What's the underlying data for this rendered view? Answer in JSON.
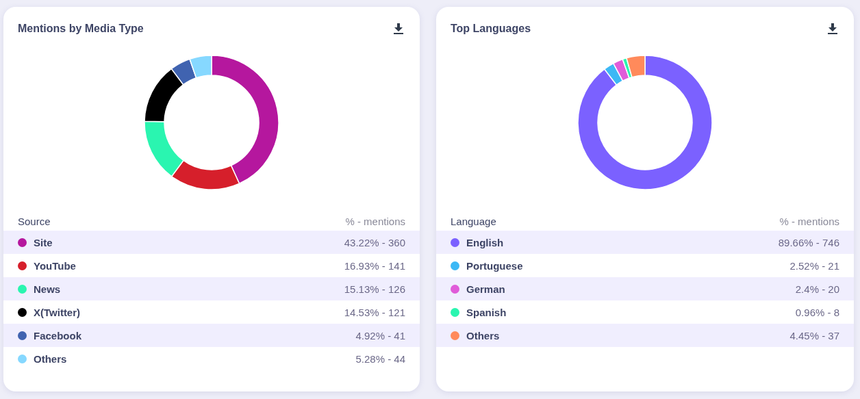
{
  "cards": [
    {
      "title": "Mentions by Media Type",
      "label_header": "Source",
      "value_header": "% - mentions",
      "chart_data": {
        "type": "donut",
        "values": [
          43.22,
          16.93,
          15.13,
          14.53,
          4.92,
          5.28
        ]
      },
      "rows": [
        {
          "label": "Site",
          "value": "43.22% - 360",
          "color": "#b5179e"
        },
        {
          "label": "YouTube",
          "value": "16.93% - 141",
          "color": "#d61f2b"
        },
        {
          "label": "News",
          "value": "15.13% - 126",
          "color": "#2af5b0"
        },
        {
          "label": "X(Twitter)",
          "value": "14.53% - 121",
          "color": "#000000"
        },
        {
          "label": "Facebook",
          "value": "4.92% - 41",
          "color": "#4063b0"
        },
        {
          "label": "Others",
          "value": "5.28% - 44",
          "color": "#86d8ff"
        }
      ]
    },
    {
      "title": "Top Languages",
      "label_header": "Language",
      "value_header": "% - mentions",
      "chart_data": {
        "type": "donut",
        "values": [
          89.66,
          2.52,
          2.4,
          0.96,
          4.45
        ]
      },
      "rows": [
        {
          "label": "English",
          "value": "89.66% - 746",
          "color": "#7b61ff"
        },
        {
          "label": "Portuguese",
          "value": "2.52% - 21",
          "color": "#3db8f5"
        },
        {
          "label": "German",
          "value": "2.4% - 20",
          "color": "#e05cd9"
        },
        {
          "label": "Spanish",
          "value": "0.96% - 8",
          "color": "#2af5b0"
        },
        {
          "label": "Others",
          "value": "4.45% - 37",
          "color": "#ff8a5b"
        }
      ]
    }
  ]
}
